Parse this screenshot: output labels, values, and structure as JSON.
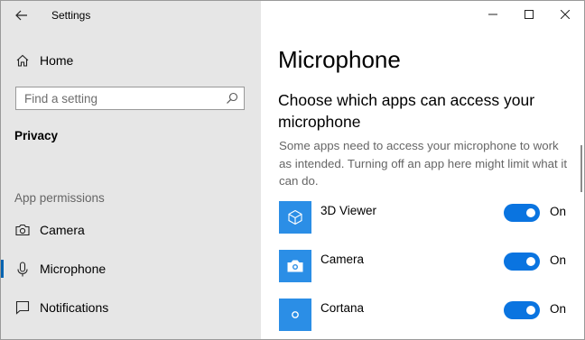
{
  "window": {
    "title": "Settings"
  },
  "sidebar": {
    "home_label": "Home",
    "search_placeholder": "Find a setting",
    "section_title": "Privacy",
    "group_label": "App permissions",
    "items": [
      {
        "label": "Camera",
        "icon": "camera-icon"
      },
      {
        "label": "Microphone",
        "icon": "microphone-icon",
        "selected": true
      },
      {
        "label": "Notifications",
        "icon": "notifications-icon"
      }
    ]
  },
  "main": {
    "page_title": "Microphone",
    "subheading": "Choose which apps can access your microphone",
    "description": "Some apps need to access your microphone to work as intended. Turning off an app here might limit what it can do.",
    "apps": [
      {
        "name": "3D Viewer",
        "icon": "cube-icon",
        "state": "On",
        "enabled": true
      },
      {
        "name": "Camera",
        "icon": "camera-icon",
        "state": "On",
        "enabled": true
      },
      {
        "name": "Cortana",
        "icon": "cortana-icon",
        "state": "On",
        "enabled": true
      }
    ]
  },
  "colors": {
    "accent": "#0a74e0",
    "tile": "#2b8ee6",
    "sidebar_bg": "#e6e6e6"
  }
}
